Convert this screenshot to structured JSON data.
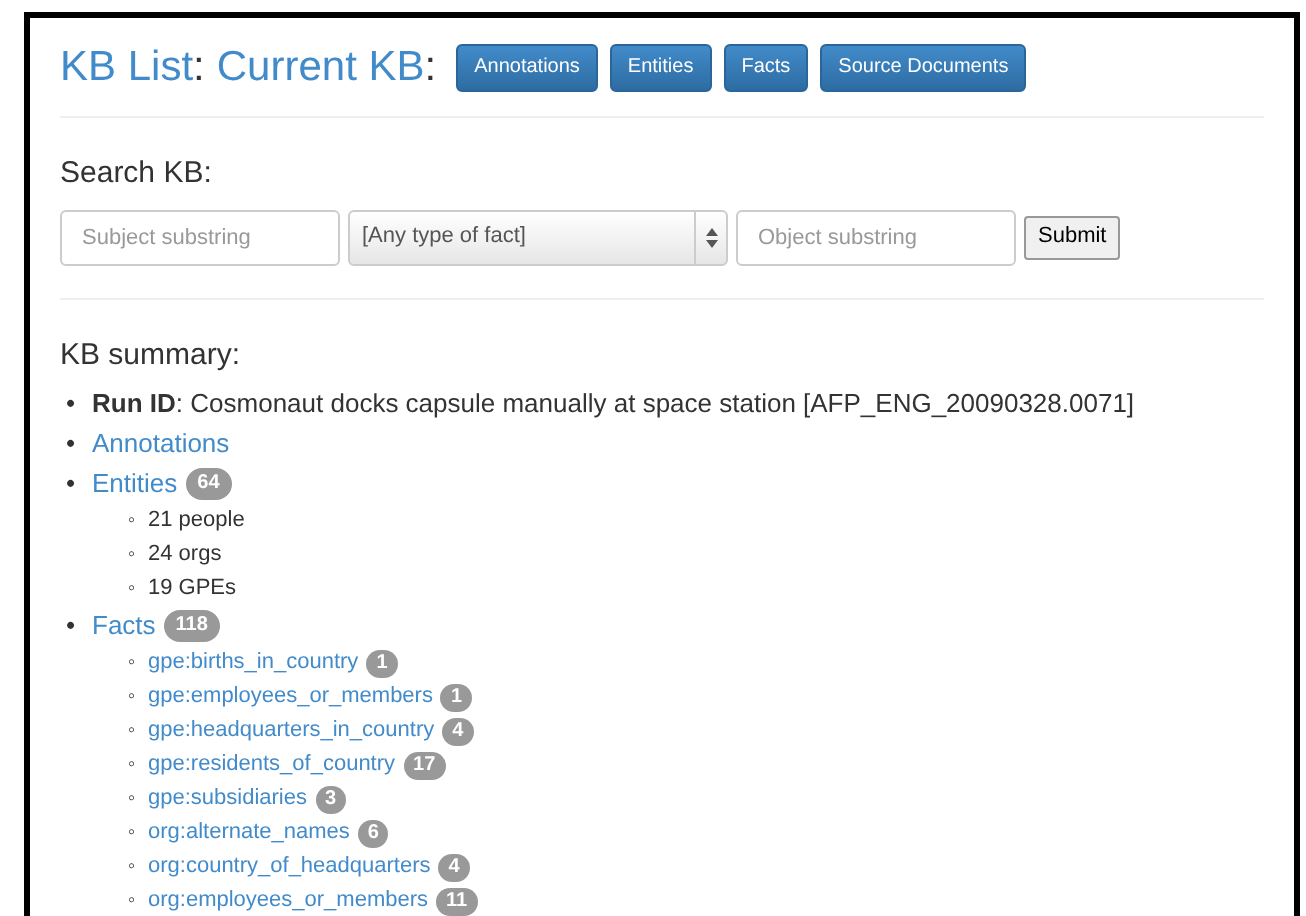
{
  "header": {
    "links": [
      "KB List",
      "Current KB"
    ],
    "separator": ":",
    "buttons": [
      "Annotations",
      "Entities",
      "Facts",
      "Source Documents"
    ]
  },
  "search": {
    "title": "Search KB:",
    "subject": {
      "placeholder": "Subject substring"
    },
    "fact_type": {
      "value": "[Any type of fact]"
    },
    "object": {
      "placeholder": "Object substring"
    },
    "submit": "Submit"
  },
  "summary": {
    "title": "KB summary:",
    "bullet": "•",
    "sub_bullet": "◦",
    "run_id": {
      "label": "Run ID",
      "sep": ":",
      "value": "Cosmonaut docks capsule manually at space station [AFP_ENG_20090328.0071]"
    },
    "annotations": "Annotations",
    "entities": {
      "label": "Entities",
      "count": "64",
      "items": [
        "21 people",
        "24 orgs",
        "19 GPEs"
      ]
    },
    "facts": {
      "label": "Facts",
      "count": "118",
      "items": [
        {
          "label": "gpe:births_in_country",
          "count": "1"
        },
        {
          "label": "gpe:employees_or_members",
          "count": "1"
        },
        {
          "label": "gpe:headquarters_in_country",
          "count": "4"
        },
        {
          "label": "gpe:residents_of_country",
          "count": "17"
        },
        {
          "label": "gpe:subsidiaries",
          "count": "3"
        },
        {
          "label": "org:alternate_names",
          "count": "6"
        },
        {
          "label": "org:country_of_headquarters",
          "count": "4"
        },
        {
          "label": "org:employees_or_members",
          "count": "11"
        }
      ]
    }
  }
}
